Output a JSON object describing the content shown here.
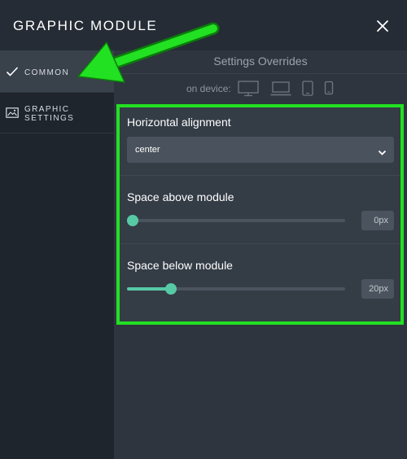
{
  "header": {
    "title": "GRAPHIC MODULE",
    "close_icon": "close-icon"
  },
  "sidebar": {
    "items": [
      {
        "label": "COMMON",
        "icon": "check-icon",
        "active": true
      },
      {
        "label_line1": "GRAPHIC",
        "label_line2": "SETTINGS",
        "icon": "image-icon",
        "active": false
      }
    ]
  },
  "overrides": {
    "title": "Settings Overrides",
    "device_label": "on device:",
    "devices": [
      "desktop-icon",
      "laptop-icon",
      "tablet-icon",
      "phone-icon"
    ]
  },
  "settings": {
    "horizontal_alignment": {
      "label": "Horizontal alignment",
      "value": "center"
    },
    "space_above": {
      "label": "Space above module",
      "value_text": "0px",
      "fraction": 0.0
    },
    "space_below": {
      "label": "Space below module",
      "value_text": "20px",
      "fraction": 0.2
    }
  },
  "colors": {
    "accent": "#57c9a5",
    "highlight": "#22e022",
    "background": "#2a313b"
  }
}
